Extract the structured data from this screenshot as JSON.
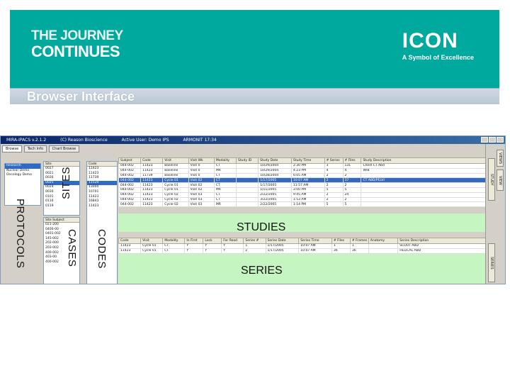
{
  "slide": {
    "tagline_line1": "THE JOURNEY",
    "tagline_line2": "CONTINUES",
    "logo_text": "ICON",
    "logo_tag": "A Symbol of Excellence",
    "title": "Browser Interface"
  },
  "app": {
    "title_items": [
      "MIRA-IPACS v.2.1.2",
      "(C) Reason Bioscience",
      "Active User: Demo IPS",
      "ARMONIT 17:34"
    ],
    "tabs": [
      "Browse",
      "Tech Info",
      "Chart Browse"
    ],
    "protocols_panel": {
      "rows": [
        "Research",
        "Nuclear Demo",
        "Oncology Demo"
      ]
    },
    "sites_panel": {
      "header": "Site",
      "rows": [
        "0027",
        "0021",
        "0026",
        "0025",
        "0024",
        "0030",
        "0101",
        "0116",
        "0119"
      ]
    },
    "codes_panel": {
      "header": "Code",
      "rows": [
        "11423",
        "11423",
        "11739",
        "11520",
        "13000",
        "10701",
        "11423",
        "16843",
        "11423"
      ]
    },
    "cases_panel": {
      "header": "Site Subject",
      "rows": [
        "021-200",
        "0400-00",
        "0401-002",
        "145-002",
        "202-000",
        "203-002",
        "400-002",
        "403-00",
        "400-002"
      ]
    },
    "studies": {
      "columns": [
        "Subject",
        "Code",
        "Visit",
        "Visit Wk",
        "Modality",
        "Study ID",
        "Study Date",
        "Study Time",
        "# Series",
        "# Files",
        "Study Description"
      ],
      "rows": [
        [
          "044-002",
          "11423",
          "Baseline",
          "Visit 0",
          "CT",
          "",
          "10/29/2004",
          "2:30 PM",
          "3",
          "131",
          "Chest CT Abd"
        ],
        [
          "044-002",
          "11423",
          "Baseline",
          "Visit 0",
          "MR",
          "",
          "10/29/2004",
          "4:23 PM",
          "4",
          "4",
          "W/B"
        ],
        [
          "044-002",
          "11739",
          "Baseline",
          "Visit 0",
          "CT",
          "",
          "10/28/2004",
          "6:05 AM",
          "2",
          "2",
          ""
        ],
        [
          "044-002",
          "11423",
          "Cycle 01",
          "Visit 02",
          "CT",
          "",
          "1/17/2005",
          "10:07 AM",
          "2",
          "37",
          "CT ABD/PELVI"
        ],
        [
          "044-002",
          "11423",
          "Cycle 01",
          "Visit 02",
          "CT",
          "",
          "1/17/2005",
          "11:57 AM",
          "2",
          "2",
          ""
        ],
        [
          "044-002",
          "11423",
          "Cycle 01",
          "Visit 02",
          "MR",
          "",
          "1/11/2005",
          "3:00 PM",
          "5",
          "5",
          ""
        ],
        [
          "044-002",
          "11423",
          "Cycle 02",
          "Visit 03",
          "CT",
          "",
          "2/22/2005",
          "9:45 AM",
          "2",
          "24",
          ""
        ],
        [
          "044-002",
          "11423",
          "Cycle 02",
          "Visit 03",
          "CT",
          "",
          "3/22/2005",
          "1:53 AM",
          "2",
          "2",
          ""
        ],
        [
          "044-002",
          "11423",
          "Cycle 02",
          "Visit 03",
          "MR",
          "",
          "2/22/2005",
          "1:14 PM",
          "5",
          "5",
          ""
        ]
      ]
    },
    "series": {
      "columns": [
        "Code",
        "Visit",
        "Modality",
        "In First",
        "Lock",
        "For Read",
        "Series #",
        "Series Date",
        "Series Time",
        "# Files",
        "# Frames",
        "Anatomy",
        "Series Description"
      ],
      "rows": [
        [
          "11423",
          "Cycle 01",
          "CT",
          "Y",
          "Y",
          "Y",
          "1",
          "1/17/2005",
          "10:07 AM",
          "1",
          "1",
          "",
          "SCOUT ABD"
        ],
        [
          "11423",
          "Cycle 01",
          "CT",
          "Y",
          "Y",
          "Y",
          "2",
          "1/17/2005",
          "10:07 AM",
          "36",
          "36",
          "",
          "HELICAL ABD"
        ]
      ]
    },
    "labels": {
      "protocols": "PROTOCOLS",
      "sites": "SITES",
      "cases": "CASES",
      "codes": "CODES",
      "studies": "STUDIES",
      "series": "SERIES"
    },
    "right_bar": {
      "study_label": "STUDY",
      "series_label": "SERIES",
      "views_label": "VIEWS",
      "view_label": "VIEW"
    }
  },
  "colors": {
    "banner": "#00a99d",
    "selection": "#316ac5",
    "green_zone": "#c5f5c0"
  }
}
